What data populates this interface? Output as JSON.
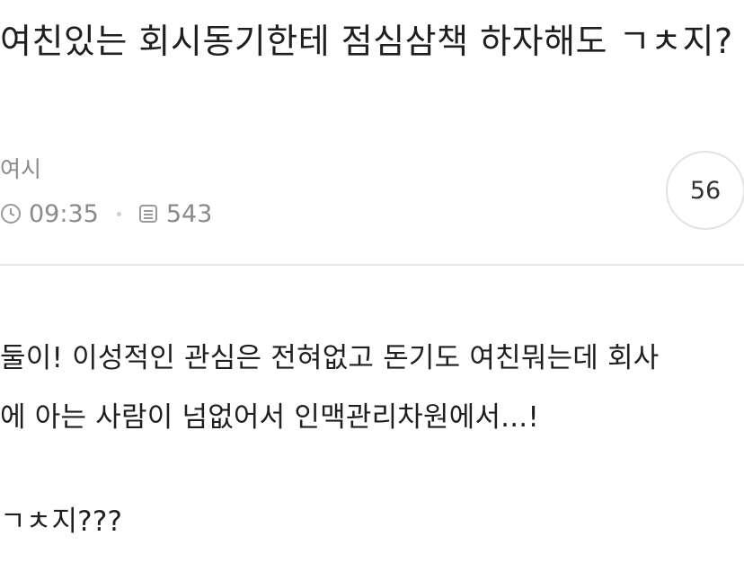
{
  "post": {
    "title": "여친있는 회시동기한테 점심삼책 하자해도 ㄱㅊ지?",
    "author": "여시",
    "time": "09:35",
    "views": "543",
    "comment_count": "56",
    "body": {
      "line1": "둘이! 이성적인 관심은 전혀없고 돈기도 여친뭐는데 회사",
      "line2": "에 아는 사람이 넘없어서 인맥관리차원에서...!",
      "line3": "ㄱㅊ지???"
    }
  },
  "icons": {
    "time": "clock-icon",
    "views": "document-icon"
  },
  "colors": {
    "text": "#1f1f1f",
    "meta": "#8a8a8a",
    "divider": "#e6e6e6",
    "circle_border": "#e2e2e2"
  }
}
